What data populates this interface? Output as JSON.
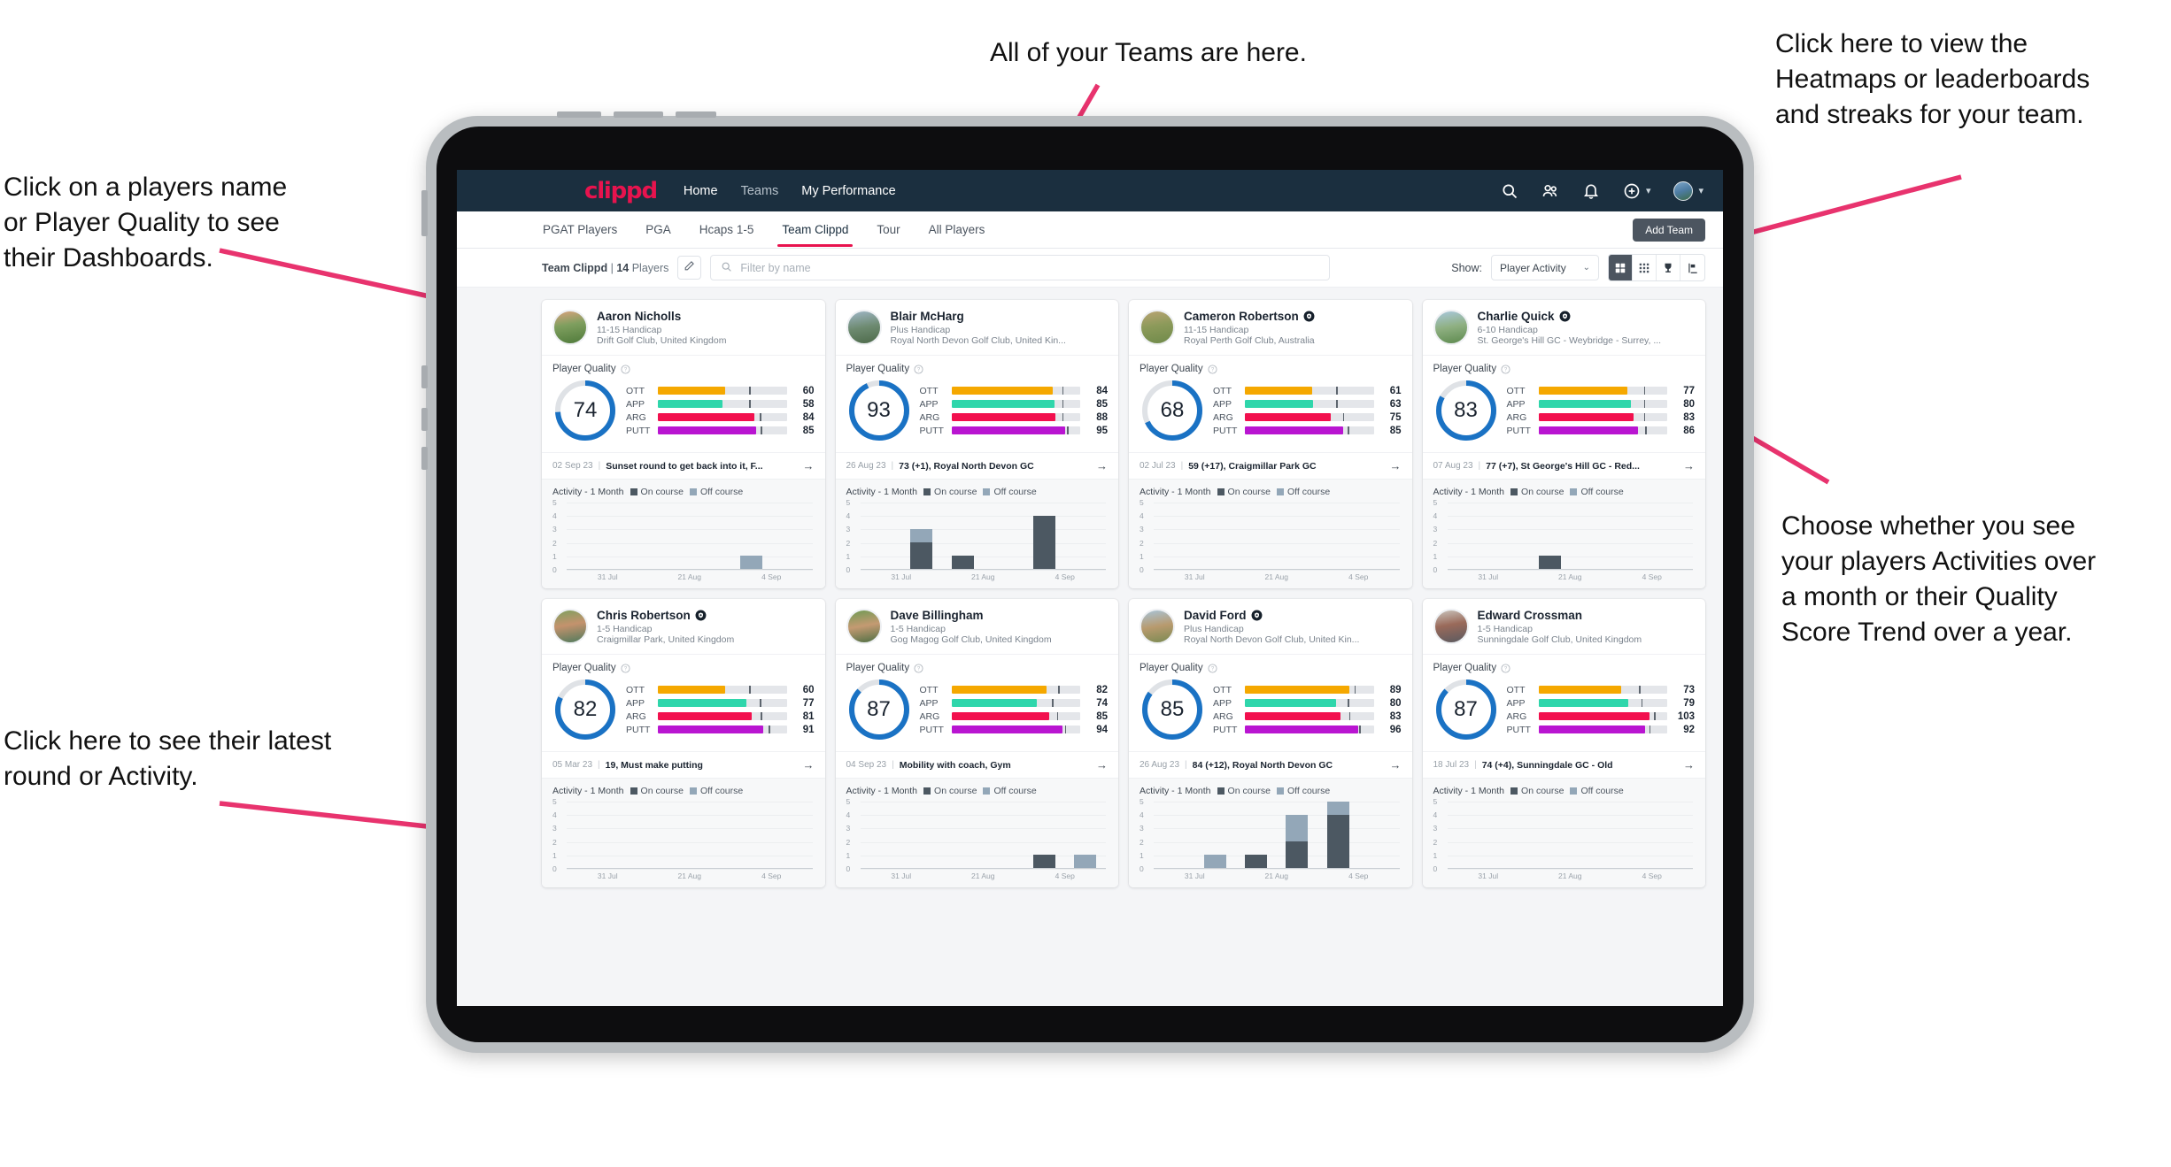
{
  "annotations": [
    {
      "id": "teams",
      "text": "All of your Teams are here."
    },
    {
      "id": "heatmaps",
      "text": "Click here to view the\nHeatmaps or leaderboards\nand streaks for your team."
    },
    {
      "id": "dashboards",
      "text": "Click on a players name\nor Player Quality to see\ntheir Dashboards."
    },
    {
      "id": "activity-choice",
      "text": "Choose whether you see\nyour players Activities over\na month or their Quality\nScore Trend over a year."
    },
    {
      "id": "latest-round",
      "text": "Click here to see their latest\nround or Activity."
    }
  ],
  "colors": {
    "brand": "#e8134e",
    "nav_bg": "#1b2f3f",
    "ring": "#1a72c4",
    "ott": "#f5a800",
    "app": "#2fd6ab",
    "arg": "#f2104e",
    "putt": "#b915d1",
    "on_course": "#4c5862",
    "off_course": "#93a7b8",
    "annotation_arrow": "#e8336e"
  },
  "topnav": {
    "brand": "clippd",
    "links": [
      {
        "label": "Home",
        "active": true
      },
      {
        "label": "Teams",
        "active": false
      },
      {
        "label": "My Performance",
        "active": false
      }
    ],
    "icons": [
      "search-icon",
      "people-icon",
      "bell-icon",
      "plus-circle-icon",
      "avatar"
    ]
  },
  "tabs": [
    {
      "label": "PGAT Players",
      "active": false
    },
    {
      "label": "PGA",
      "active": false
    },
    {
      "label": "Hcaps 1-5",
      "active": false
    },
    {
      "label": "Team Clippd",
      "active": true
    },
    {
      "label": "Tour",
      "active": false
    },
    {
      "label": "All Players",
      "active": false
    }
  ],
  "add_team_label": "Add Team",
  "toolbar": {
    "team_name": "Team Clippd",
    "separator": "|",
    "player_count": "14",
    "players_word": "Players",
    "edit_icon": "pencil-icon",
    "search_placeholder": "Filter by name",
    "show_label": "Show:",
    "show_value": "Player Activity",
    "view_buttons": [
      {
        "name": "grid-view-icon",
        "selected": true
      },
      {
        "name": "dense-grid-icon",
        "selected": false
      },
      {
        "name": "trophy-icon",
        "selected": false
      },
      {
        "name": "heatmap-icon",
        "selected": false
      }
    ]
  },
  "card_labels": {
    "quality_title": "Player Quality",
    "activity_title": "Activity - 1 Month",
    "on_course": "On course",
    "off_course": "Off course",
    "metrics": [
      "OTT",
      "APP",
      "ARG",
      "PUTT"
    ]
  },
  "chart_data": {
    "type": "bar",
    "title": "Activity - 1 Month",
    "xlabel": "",
    "ylabel": "",
    "ylim": [
      0,
      5
    ],
    "yticks": [
      5,
      4,
      3,
      2,
      1,
      0
    ],
    "xticks": [
      "31 Jul",
      "21 Aug",
      "4 Sep"
    ],
    "legend": [
      "On course",
      "Off course"
    ],
    "legend_position": "top",
    "grid": true,
    "stacked": true,
    "series_charts": [
      {
        "player": "Aaron Nicholls",
        "bins": 6,
        "on_course": [
          0,
          0,
          0,
          0,
          0,
          0
        ],
        "off_course": [
          0,
          0,
          0,
          0,
          1,
          0
        ]
      },
      {
        "player": "Blair McHarg",
        "bins": 6,
        "on_course": [
          0,
          2,
          1,
          0,
          4,
          0
        ],
        "off_course": [
          0,
          1,
          0,
          0,
          0,
          0
        ]
      },
      {
        "player": "Cameron Robertson",
        "bins": 6,
        "on_course": [
          0,
          0,
          0,
          0,
          0,
          0
        ],
        "off_course": [
          0,
          0,
          0,
          0,
          0,
          0
        ]
      },
      {
        "player": "Charlie Quick",
        "bins": 6,
        "on_course": [
          0,
          0,
          1,
          0,
          0,
          0
        ],
        "off_course": [
          0,
          0,
          0,
          0,
          0,
          0
        ]
      },
      {
        "player": "Chris Robertson",
        "bins": 6,
        "on_course": [
          0,
          0,
          0,
          0,
          0,
          0
        ],
        "off_course": [
          0,
          0,
          0,
          0,
          0,
          0
        ]
      },
      {
        "player": "Dave Billingham",
        "bins": 6,
        "on_course": [
          0,
          0,
          0,
          0,
          1,
          0
        ],
        "off_course": [
          0,
          0,
          0,
          0,
          0,
          1
        ]
      },
      {
        "player": "David Ford",
        "bins": 6,
        "on_course": [
          0,
          0,
          1,
          2,
          4,
          0
        ],
        "off_course": [
          0,
          1,
          0,
          2,
          1,
          0
        ]
      },
      {
        "player": "Edward Crossman",
        "bins": 6,
        "on_course": [
          0,
          0,
          0,
          0,
          0,
          0
        ],
        "off_course": [
          0,
          0,
          0,
          0,
          0,
          0
        ]
      }
    ]
  },
  "players": [
    {
      "name": "Aaron Nicholls",
      "verified": false,
      "handicap": "11-15 Handicap",
      "club": "Drift Golf Club, United Kingdom",
      "quality": 74,
      "metrics": [
        {
          "label": "OTT",
          "value": 60,
          "fill": 52,
          "tick": 71
        },
        {
          "label": "APP",
          "value": 58,
          "fill": 50,
          "tick": 71
        },
        {
          "label": "ARG",
          "value": 84,
          "fill": 75,
          "tick": 79
        },
        {
          "label": "PUTT",
          "value": 85,
          "fill": 76,
          "tick": 80
        }
      ],
      "latest_date": "02 Sep 23",
      "latest_text": "Sunset round to get back into it, F...",
      "avatar": "linear-gradient(170deg,#d9a27e 0%,#7f9f5f 42%,#4f7a3a 100%)"
    },
    {
      "name": "Blair McHarg",
      "verified": false,
      "handicap": "Plus Handicap",
      "club": "Royal North Devon Golf Club, United Kin...",
      "quality": 93,
      "metrics": [
        {
          "label": "OTT",
          "value": 84,
          "fill": 79,
          "tick": 86
        },
        {
          "label": "APP",
          "value": 85,
          "fill": 80,
          "tick": 86
        },
        {
          "label": "ARG",
          "value": 88,
          "fill": 81,
          "tick": 86
        },
        {
          "label": "PUTT",
          "value": 95,
          "fill": 88,
          "tick": 90
        }
      ],
      "latest_date": "26 Aug 23",
      "latest_text": "73 (+1), Royal North Devon GC",
      "avatar": "linear-gradient(170deg,#9fb6c6 0%,#6d8a70 50%,#4d6a4a 100%)"
    },
    {
      "name": "Cameron Robertson",
      "verified": true,
      "handicap": "11-15 Handicap",
      "club": "Royal Perth Golf Club, Australia",
      "quality": 68,
      "metrics": [
        {
          "label": "OTT",
          "value": 61,
          "fill": 52,
          "tick": 71
        },
        {
          "label": "APP",
          "value": 63,
          "fill": 53,
          "tick": 71
        },
        {
          "label": "ARG",
          "value": 75,
          "fill": 67,
          "tick": 76
        },
        {
          "label": "PUTT",
          "value": 85,
          "fill": 76,
          "tick": 80
        }
      ],
      "latest_date": "02 Jul 23",
      "latest_text": "59 (+17), Craigmillar Park GC",
      "avatar": "linear-gradient(170deg,#b9a474 0%,#8c9a5a 45%,#6f8a4a 100%)"
    },
    {
      "name": "Charlie Quick",
      "verified": true,
      "handicap": "6-10 Handicap",
      "club": "St. George's Hill GC - Weybridge - Surrey, ...",
      "quality": 83,
      "metrics": [
        {
          "label": "OTT",
          "value": 77,
          "fill": 69,
          "tick": 82
        },
        {
          "label": "APP",
          "value": 80,
          "fill": 72,
          "tick": 82
        },
        {
          "label": "ARG",
          "value": 83,
          "fill": 74,
          "tick": 82
        },
        {
          "label": "PUTT",
          "value": 86,
          "fill": 77,
          "tick": 83
        }
      ],
      "latest_date": "07 Aug 23",
      "latest_text": "77 (+7), St George's Hill GC - Red...",
      "avatar": "linear-gradient(170deg,#a9c8dd 0%,#8fb082 48%,#5d8a4e 100%)"
    },
    {
      "name": "Chris Robertson",
      "verified": true,
      "handicap": "1-5 Handicap",
      "club": "Craigmillar Park, United Kingdom",
      "quality": 82,
      "metrics": [
        {
          "label": "OTT",
          "value": 60,
          "fill": 52,
          "tick": 71
        },
        {
          "label": "APP",
          "value": 77,
          "fill": 69,
          "tick": 79
        },
        {
          "label": "ARG",
          "value": 81,
          "fill": 73,
          "tick": 80
        },
        {
          "label": "PUTT",
          "value": 91,
          "fill": 82,
          "tick": 86
        }
      ],
      "latest_date": "05 Mar 23",
      "latest_text": "19, Must make putting",
      "avatar": "linear-gradient(170deg,#7fa05f 0%,#c4926d 45%,#4f7a5c 100%)"
    },
    {
      "name": "Dave Billingham",
      "verified": false,
      "handicap": "1-5 Handicap",
      "club": "Gog Magog Golf Club, United Kingdom",
      "quality": 87,
      "metrics": [
        {
          "label": "OTT",
          "value": 82,
          "fill": 74,
          "tick": 83
        },
        {
          "label": "APP",
          "value": 74,
          "fill": 66,
          "tick": 78
        },
        {
          "label": "ARG",
          "value": 85,
          "fill": 76,
          "tick": 82
        },
        {
          "label": "PUTT",
          "value": 94,
          "fill": 86,
          "tick": 88
        }
      ],
      "latest_date": "04 Sep 23",
      "latest_text": "Mobility with coach, Gym",
      "avatar": "linear-gradient(170deg,#6f9a54 0%,#c49a72 48%,#4e6f44 100%)"
    },
    {
      "name": "David Ford",
      "verified": true,
      "handicap": "Plus Handicap",
      "club": "Royal North Devon Golf Club, United Kin...",
      "quality": 85,
      "metrics": [
        {
          "label": "OTT",
          "value": 89,
          "fill": 81,
          "tick": 85
        },
        {
          "label": "APP",
          "value": 80,
          "fill": 71,
          "tick": 80
        },
        {
          "label": "ARG",
          "value": 83,
          "fill": 74,
          "tick": 81
        },
        {
          "label": "PUTT",
          "value": 96,
          "fill": 88,
          "tick": 89
        }
      ],
      "latest_date": "26 Aug 23",
      "latest_text": "84 (+12), Royal North Devon GC",
      "avatar": "linear-gradient(170deg,#a8c4d8 0%,#b89a6e 50%,#7a8a52 100%)"
    },
    {
      "name": "Edward Crossman",
      "verified": false,
      "handicap": "1-5 Handicap",
      "club": "Sunningdale Golf Club, United Kingdom",
      "quality": 87,
      "metrics": [
        {
          "label": "OTT",
          "value": 73,
          "fill": 64,
          "tick": 78
        },
        {
          "label": "APP",
          "value": 79,
          "fill": 70,
          "tick": 80
        },
        {
          "label": "ARG",
          "value": 103,
          "fill": 86,
          "tick": 90
        },
        {
          "label": "PUTT",
          "value": 92,
          "fill": 83,
          "tick": 86
        }
      ],
      "latest_date": "18 Jul 23",
      "latest_text": "74 (+4), Sunningdale GC - Old",
      "avatar": "linear-gradient(170deg,#c9c4bd 0%,#9a6a5a 45%,#5a5a60 100%)"
    }
  ]
}
